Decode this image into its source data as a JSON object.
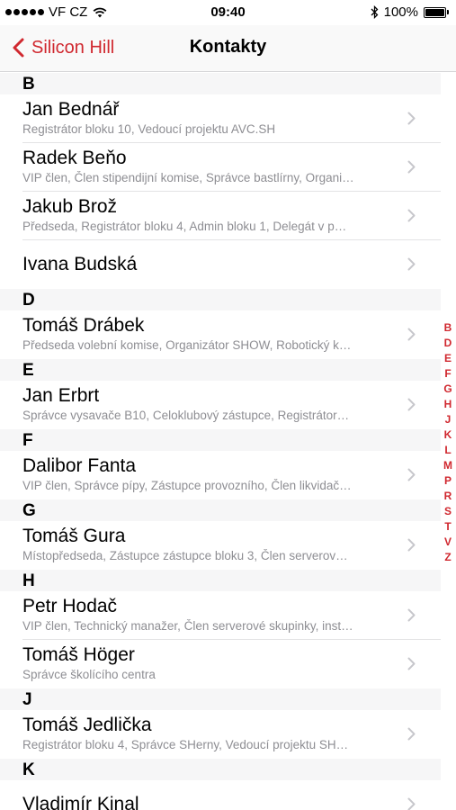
{
  "status": {
    "carrier": "VF CZ",
    "time": "09:40",
    "battery": "100%"
  },
  "nav": {
    "back_label": "Silicon Hill",
    "title": "Kontakty"
  },
  "sections": [
    {
      "letter": "B",
      "rows": [
        {
          "name": "Jan Bednář",
          "detail": "Registrátor bloku 10, Vedoucí projektu AVC.SH"
        },
        {
          "name": "Radek Beňo",
          "detail": "VIP člen, Člen stipendijní komise, Správce bastlírny, Organi…"
        },
        {
          "name": "Jakub Brož",
          "detail": "Předseda, Registrátor bloku 4, Admin bloku 1, Delegát v p…"
        },
        {
          "name": "Ivana Budská",
          "detail": ""
        }
      ]
    },
    {
      "letter": "D",
      "rows": [
        {
          "name": "Tomáš Drábek",
          "detail": "Předseda volební komise, Organizátor SHOW, Robotický k…"
        }
      ]
    },
    {
      "letter": "E",
      "rows": [
        {
          "name": "Jan Erbrt",
          "detail": "Správce vysavače B10, Celoklubový zástupce, Registrátor…"
        }
      ]
    },
    {
      "letter": "F",
      "rows": [
        {
          "name": "Dalibor Fanta",
          "detail": "VIP člen, Správce pípy, Zástupce provozního, Člen likvidač…"
        }
      ]
    },
    {
      "letter": "G",
      "rows": [
        {
          "name": "Tomáš Gura",
          "detail": "Místopředseda, Zástupce zástupce bloku 3, Člen serverov…"
        }
      ]
    },
    {
      "letter": "H",
      "rows": [
        {
          "name": "Petr Hodač",
          "detail": "VIP člen, Technický manažer, Člen serverové skupinky, inst…"
        },
        {
          "name": "Tomáš Höger",
          "detail": "Správce školícího centra"
        }
      ]
    },
    {
      "letter": "J",
      "rows": [
        {
          "name": "Tomáš Jedlička",
          "detail": "Registrátor bloku 4, Správce SHerny, Vedoucí projektu SH…"
        }
      ]
    },
    {
      "letter": "K",
      "rows": [
        {
          "name": "Vladimír Kinal",
          "detail": ""
        }
      ]
    }
  ],
  "index": [
    "B",
    "D",
    "E",
    "F",
    "G",
    "H",
    "J",
    "K",
    "L",
    "M",
    "P",
    "R",
    "S",
    "T",
    "V",
    "Z"
  ],
  "colors": {
    "accent": "#d0282f",
    "detail_text": "#8e8e93",
    "section_bg": "#f6f6f7"
  },
  "icons": {
    "back": "chevron-left-icon",
    "row": "chevron-right-icon",
    "wifi": "wifi-icon",
    "bluetooth": "bluetooth-icon",
    "battery": "battery-icon"
  }
}
